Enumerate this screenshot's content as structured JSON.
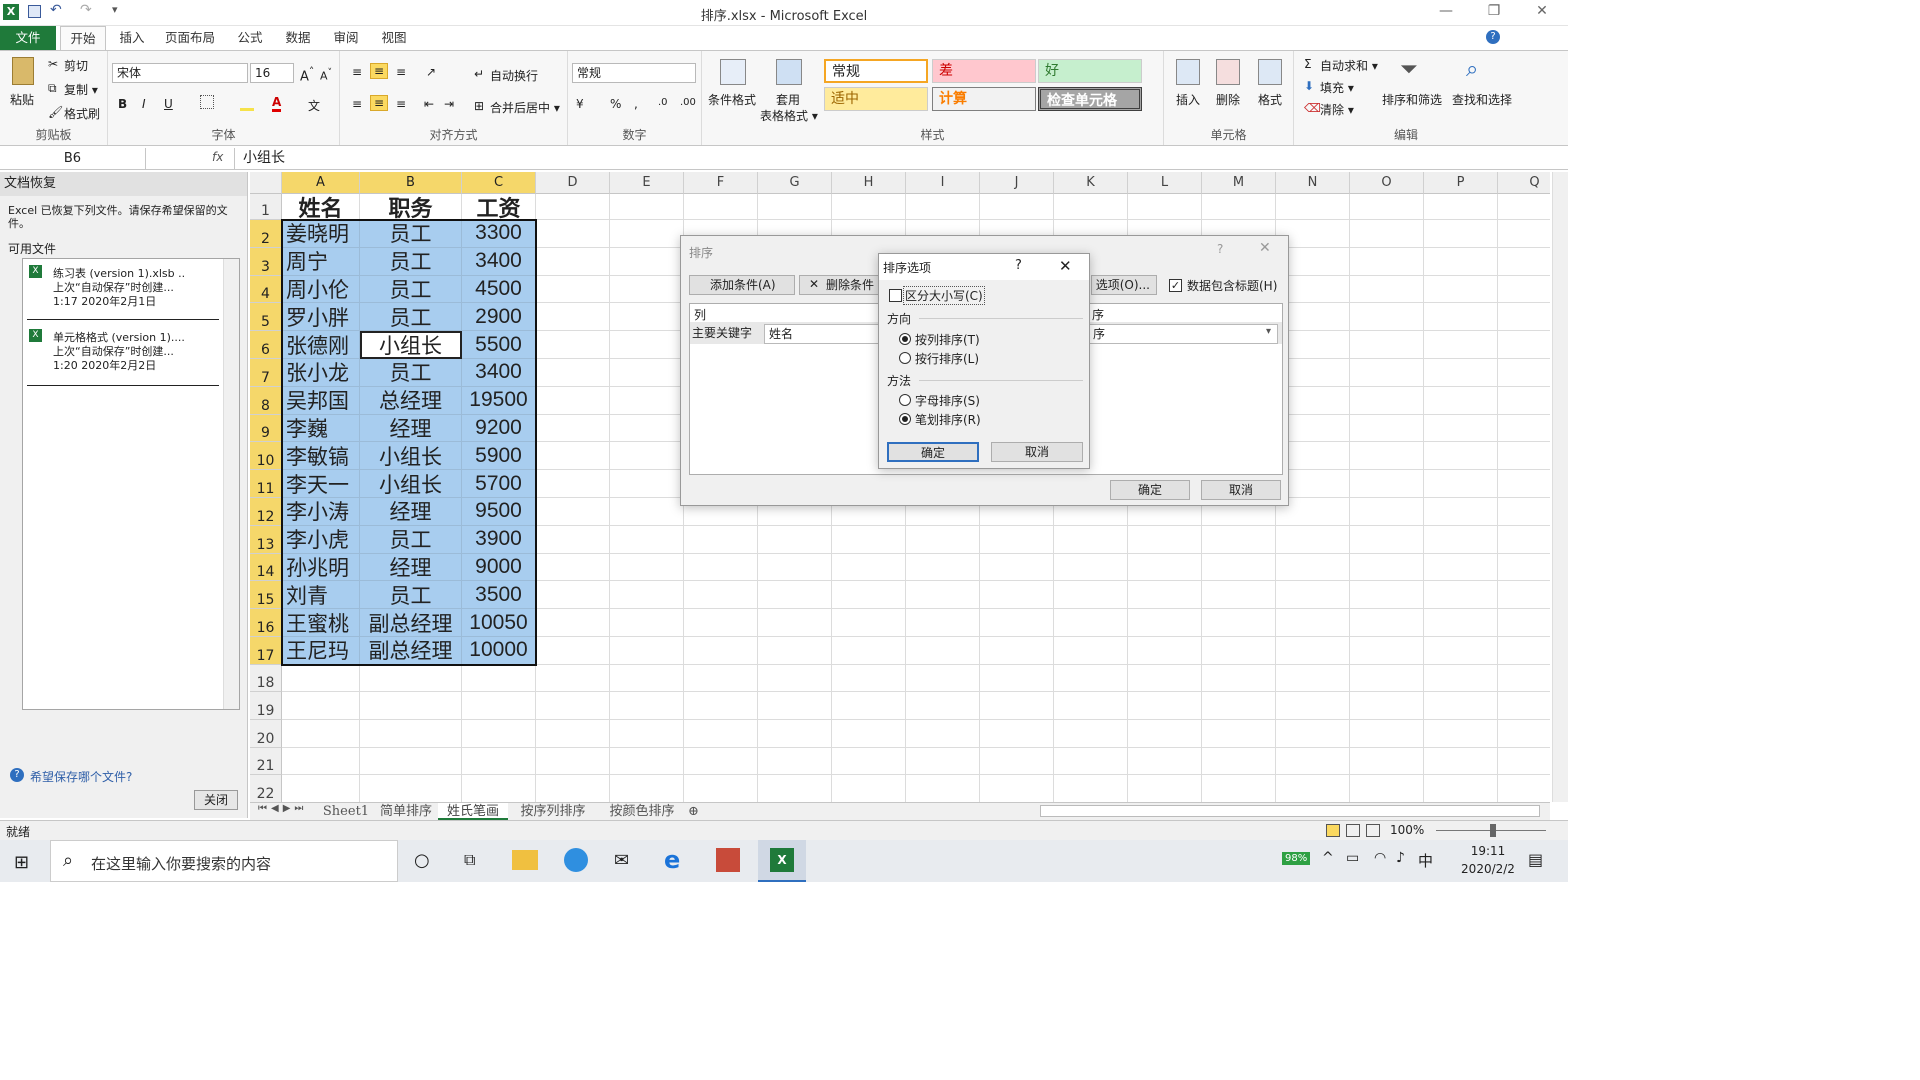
{
  "window": {
    "title": "排序.xlsx - Microsoft Excel",
    "minimize": "—",
    "restore": "❐",
    "close": "✕"
  },
  "ribbon_tabs": [
    "文件",
    "开始",
    "插入",
    "页面布局",
    "公式",
    "数据",
    "审阅",
    "视图"
  ],
  "clipboard": {
    "paste": "粘贴",
    "cut": "剪切",
    "copy": "复制 ▾",
    "format_painter": "格式刷",
    "label": "剪贴板"
  },
  "font": {
    "name": "宋体",
    "size": "16",
    "label": "字体",
    "bold": "B",
    "italic": "I",
    "underline": "U"
  },
  "alignment": {
    "wrap": "自动换行",
    "merge": "合并后居中 ▾",
    "label": "对齐方式"
  },
  "number": {
    "format": "常规",
    "percent": "%",
    "comma": ",",
    "label": "数字"
  },
  "styles": {
    "conditional": "条件格式",
    "table_format_1": "套用",
    "table_format_2": "表格格式 ▾",
    "normal": "常规",
    "bad": "差",
    "good": "好",
    "neutral": "适中",
    "calc": "计算",
    "check": "检查单元格",
    "label": "样式"
  },
  "cells_group": {
    "insert": "插入",
    "delete": "删除",
    "format": "格式",
    "label": "单元格"
  },
  "editing": {
    "autosum": "自动求和 ▾",
    "fill": "填充 ▾",
    "clear": "清除 ▾",
    "sort_filter": "排序和筛选",
    "find_select": "查找和选择",
    "label": "编辑"
  },
  "formula_bar": {
    "name_box": "B6",
    "fx": "fx",
    "value": "小组长"
  },
  "recovery": {
    "title": "文档恢复",
    "message": "Excel 已恢复下列文件。请保存希望保留的文件。",
    "available": "可用文件",
    "files": [
      {
        "name": "练习表 (version 1).xlsb ..",
        "line2": "上次“自动保存”时创建...",
        "line3": "1:17 2020年2月1日"
      },
      {
        "name": "单元格格式 (version 1)....",
        "line2": "上次“自动保存”时创建...",
        "line3": "1:20 2020年2月2日"
      }
    ],
    "help": "希望保存哪个文件?",
    "close": "关闭"
  },
  "columns": [
    "A",
    "B",
    "C",
    "D",
    "E",
    "F",
    "G",
    "H",
    "I",
    "J",
    "K",
    "L",
    "M",
    "N",
    "O",
    "P",
    "Q"
  ],
  "rows": [
    [
      "姓名",
      "职务",
      "工资"
    ],
    [
      "姜晓明",
      "员工",
      "3300"
    ],
    [
      "周宁",
      "员工",
      "3400"
    ],
    [
      "周小伦",
      "员工",
      "4500"
    ],
    [
      "罗小胖",
      "员工",
      "2900"
    ],
    [
      "张德刚",
      "小组长",
      "5500"
    ],
    [
      "张小龙",
      "员工",
      "3400"
    ],
    [
      "吴邦国",
      "总经理",
      "19500"
    ],
    [
      "李巍",
      "经理",
      "9200"
    ],
    [
      "李敏镐",
      "小组长",
      "5900"
    ],
    [
      "李天一",
      "小组长",
      "5700"
    ],
    [
      "李小涛",
      "经理",
      "9500"
    ],
    [
      "李小虎",
      "员工",
      "3900"
    ],
    [
      "孙兆明",
      "经理",
      "9000"
    ],
    [
      "刘青",
      "员工",
      "3500"
    ],
    [
      "王蜜桃",
      "副总经理",
      "10050"
    ],
    [
      "王尼玛",
      "副总经理",
      "10000"
    ]
  ],
  "row_numbers": [
    "1",
    "2",
    "3",
    "4",
    "5",
    "6",
    "7",
    "8",
    "9",
    "10",
    "11",
    "12",
    "13",
    "14",
    "15",
    "16",
    "17",
    "18",
    "19",
    "20",
    "21",
    "22"
  ],
  "sheet_tabs": [
    "Sheet1",
    "简单排序",
    "姓氏笔画",
    "按序列排序",
    "按颜色排序"
  ],
  "active_sheet": "姓氏笔画",
  "status": {
    "ready": "就绪",
    "zoom": "100%"
  },
  "sort_dialog": {
    "title": "排序",
    "add": "添加条件(A)",
    "delete": "删除条件(",
    "options": "选项(O)...",
    "has_header": "数据包含标题(H)",
    "col_header": "列",
    "order_header": "序",
    "primary_key": "主要关键字",
    "key_value": "姓名",
    "order_value": "序",
    "ok": "确定",
    "cancel": "取消"
  },
  "options_dialog": {
    "title": "排序选项",
    "help": "?",
    "case": "区分大小写(C)",
    "direction": "方向",
    "by_column": "按列排序(T)",
    "by_row": "按行排序(L)",
    "method": "方法",
    "alpha": "字母排序(S)",
    "stroke": "笔划排序(R)",
    "ok": "确定",
    "cancel": "取消"
  },
  "taskbar": {
    "search": "在这里输入你要搜索的内容",
    "battery": "98%",
    "ime": "中",
    "time": "19:11",
    "date": "2020/2/2"
  }
}
